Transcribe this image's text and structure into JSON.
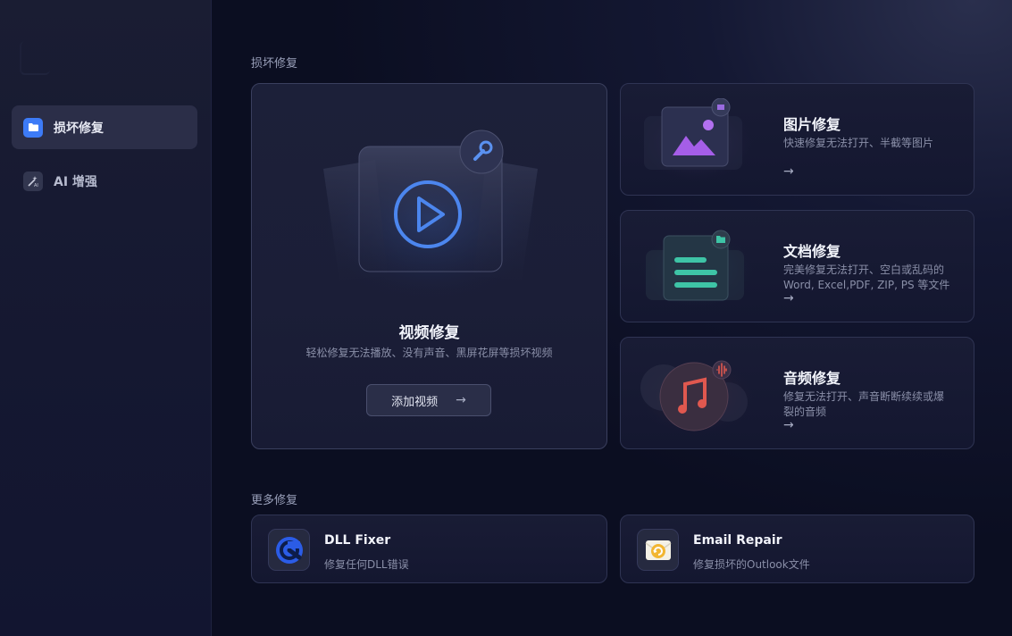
{
  "sidebar": {
    "items": [
      {
        "label": "损坏修复",
        "icon": "folder-icon",
        "active": true
      },
      {
        "label": "AI 增强",
        "icon": "ai-wand-icon",
        "active": false
      }
    ]
  },
  "main": {
    "repair_section_title": "损坏修复",
    "video": {
      "title": "视频修复",
      "desc": "轻松修复无法播放、没有声音、黑屏花屏等损坏视频",
      "button_label": "添加视频",
      "arrow": "→"
    },
    "image": {
      "title": "图片修复",
      "desc": "快速修复无法打开、半截等图片",
      "arrow": "→"
    },
    "document": {
      "title": "文档修复",
      "desc": "完美修复无法打开、空白或乱码的Word, Excel,PDF, ZIP, PS 等文件",
      "arrow": "→"
    },
    "audio": {
      "title": "音频修复",
      "desc": "修复无法打开、声音断断续续或爆裂的音频",
      "arrow": "→"
    },
    "more_section_title": "更多修复",
    "more": [
      {
        "title": "DLL Fixer",
        "desc": "修复任何DLL错误",
        "icon": "dll-fixer-icon"
      },
      {
        "title": "Email Repair",
        "desc": "修复损坏的Outlook文件",
        "icon": "email-repair-icon"
      }
    ]
  },
  "colors": {
    "accent_blue": "#3d7bf7",
    "image_purple": "#a55ee8",
    "doc_teal": "#3ec4a6",
    "audio_red": "#e0584f"
  }
}
